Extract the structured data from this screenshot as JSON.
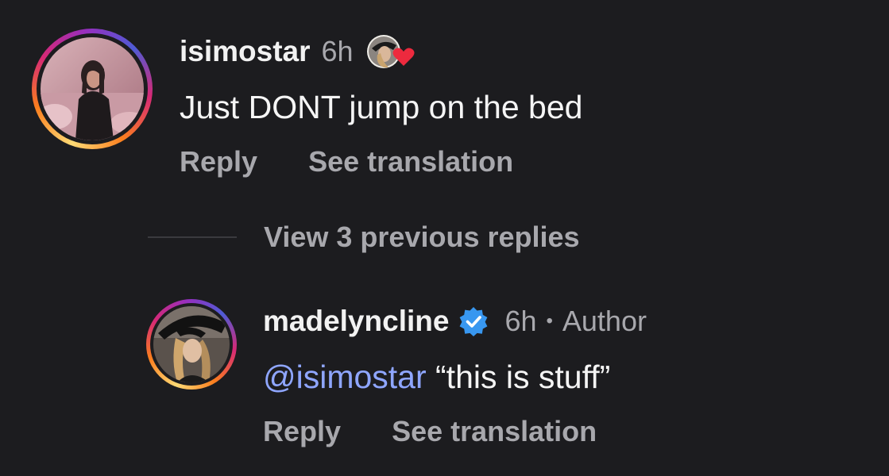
{
  "comments": [
    {
      "username": "isimostar",
      "time": "6h",
      "text": "Just DONT jump on the bed",
      "reply_label": "Reply",
      "translate_label": "See translation"
    }
  ],
  "thread": {
    "view_previous_label": "View 3 previous replies"
  },
  "reply": {
    "username": "madelyncline",
    "time": "6h",
    "separator": "•",
    "role": "Author",
    "mention": "@isimostar",
    "text": " “this is stuff”",
    "reply_label": "Reply",
    "translate_label": "See translation"
  },
  "colors": {
    "background": "#1c1c1f",
    "verified_badge": "#3897f0",
    "mention": "#8fa6ff",
    "liked_heart": "#ed2a3e"
  }
}
